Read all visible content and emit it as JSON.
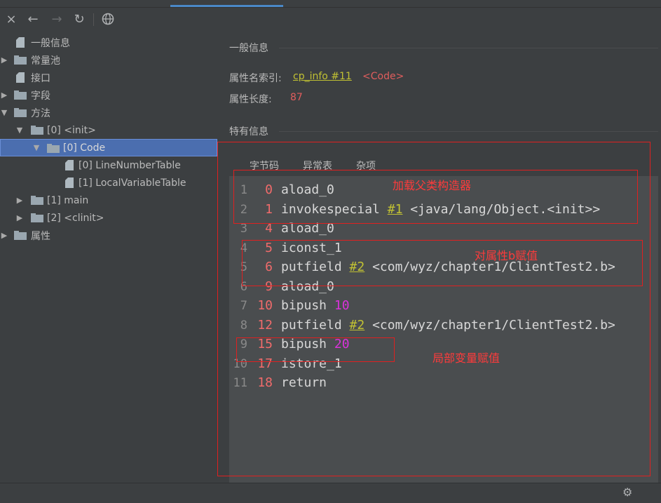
{
  "toolbar": {
    "close_icon": "×",
    "back_icon": "←",
    "forward_icon": "→",
    "refresh_icon": "↻",
    "web_icon": "globe"
  },
  "tree": [
    {
      "label": "一般信息",
      "type": "file"
    },
    {
      "label": "常量池",
      "type": "folder"
    },
    {
      "label": "接口",
      "type": "file"
    },
    {
      "label": "字段",
      "type": "folder"
    },
    {
      "label": "方法",
      "type": "folder"
    },
    {
      "label": "[0] <init>",
      "type": "folder"
    },
    {
      "label": "[0] Code",
      "type": "folder",
      "selected": true
    },
    {
      "label": "[0] LineNumberTable",
      "type": "file"
    },
    {
      "label": "[1] LocalVariableTable",
      "type": "file"
    },
    {
      "label": "[1] main",
      "type": "folder"
    },
    {
      "label": "[2] <clinit>",
      "type": "folder"
    },
    {
      "label": "属性",
      "type": "folder"
    }
  ],
  "general": {
    "title": "一般信息",
    "name_index_label": "属性名索引:",
    "name_index_link": "cp_info #11",
    "name_index_value": "<Code>",
    "length_label": "属性长度:",
    "length_value": "87"
  },
  "specific": {
    "title": "特有信息",
    "tabs": [
      "字节码",
      "异常表",
      "杂项"
    ]
  },
  "code": [
    {
      "line": "1",
      "offset": "0",
      "op": "aload_0"
    },
    {
      "line": "2",
      "offset": "1",
      "op": "invokespecial",
      "ref": "#1",
      "arg": "<java/lang/Object.<init>>"
    },
    {
      "line": "3",
      "offset": "4",
      "op": "aload_0"
    },
    {
      "line": "4",
      "offset": "5",
      "op": "iconst_1"
    },
    {
      "line": "5",
      "offset": "6",
      "op": "putfield",
      "ref": "#2",
      "arg": "<com/wyz/chapter1/ClientTest2.b>"
    },
    {
      "line": "6",
      "offset": "9",
      "op": "aload_0"
    },
    {
      "line": "7",
      "offset": "10",
      "op": "bipush",
      "const": "10"
    },
    {
      "line": "8",
      "offset": "12",
      "op": "putfield",
      "ref": "#2",
      "arg": "<com/wyz/chapter1/ClientTest2.b>"
    },
    {
      "line": "9",
      "offset": "15",
      "op": "bipush",
      "const": "20"
    },
    {
      "line": "10",
      "offset": "17",
      "op": "istore_1"
    },
    {
      "line": "11",
      "offset": "18",
      "op": "return"
    }
  ],
  "annotations": {
    "super_ctor": "加载父类构造器",
    "assign_field": "对属性b赋值",
    "assign_local": "局部变量赋值"
  },
  "colors": {
    "background": "#3c3f41",
    "selection": "#4b6eaf",
    "link": "#c1c133",
    "offset": "#f06b6b",
    "constant": "#d932d9",
    "annotation": "#ff3b3b"
  }
}
